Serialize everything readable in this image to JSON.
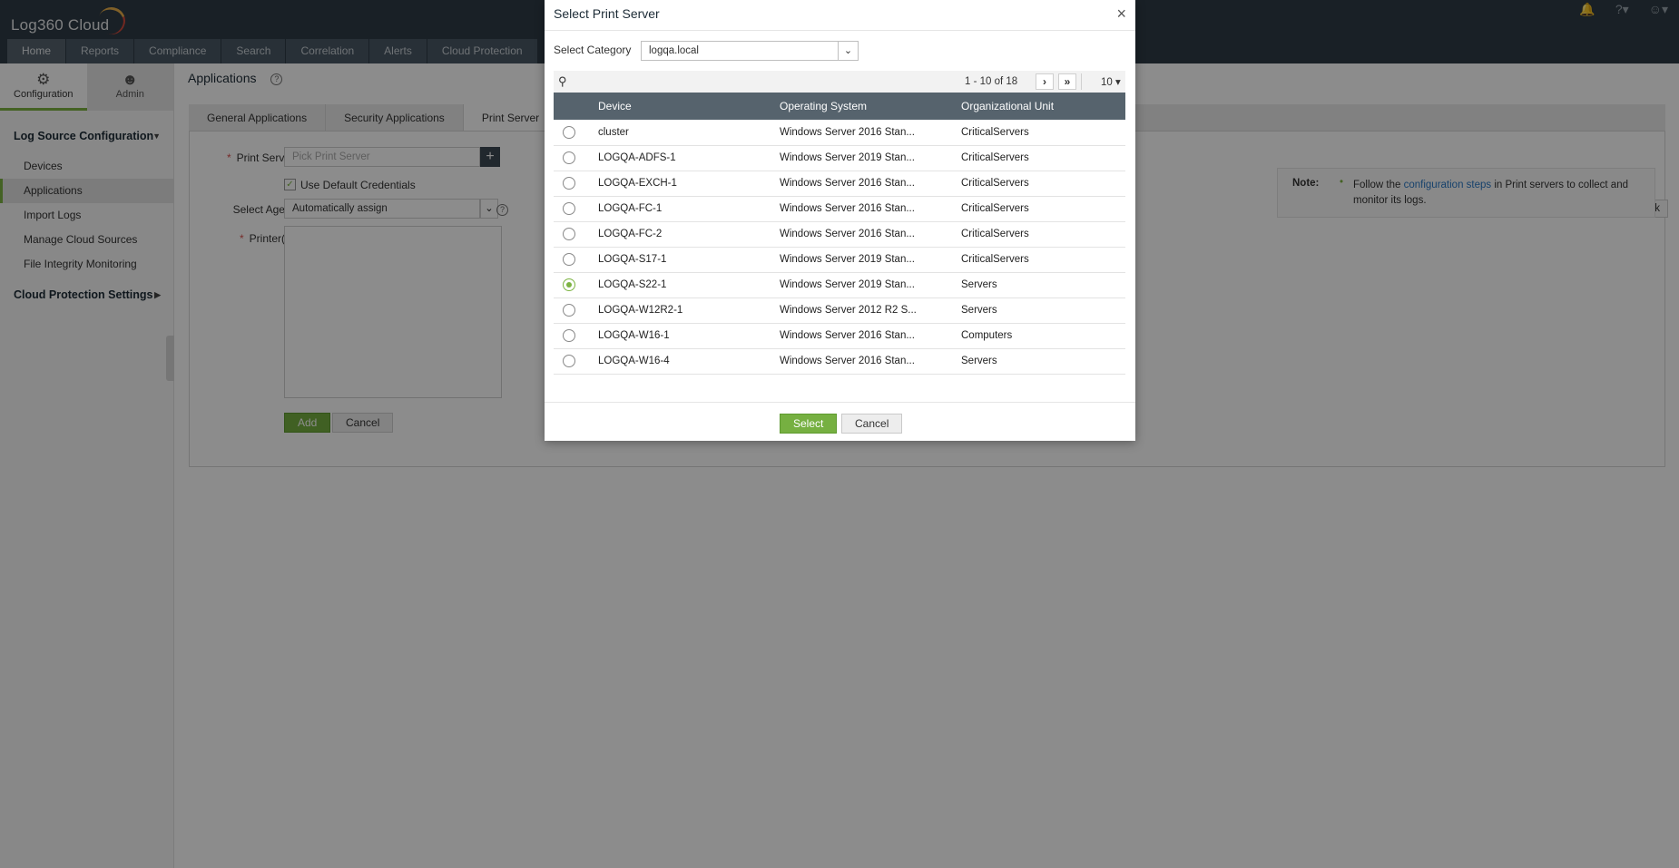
{
  "header": {
    "logo_text": "Log360 Cloud",
    "nav_tabs": [
      "Home",
      "Reports",
      "Compliance",
      "Search",
      "Correlation",
      "Alerts",
      "Cloud Protection"
    ],
    "icons": [
      "bell-icon",
      "help-icon",
      "user-icon"
    ]
  },
  "sidebar": {
    "tabs": [
      {
        "label": "Configuration",
        "icon": "gear-icon"
      },
      {
        "label": "Admin",
        "icon": "user-icon"
      }
    ],
    "section_log_source": "Log Source Configuration",
    "items": [
      "Devices",
      "Applications",
      "Import Logs",
      "Manage Cloud Sources",
      "File Integrity Monitoring"
    ],
    "section_cloud": "Cloud Protection Settings"
  },
  "main": {
    "page_title": "Applications",
    "app_tabs": [
      "General Applications",
      "Security Applications",
      "Print Server"
    ],
    "form": {
      "print_server_label": "Print Server",
      "print_server_placeholder": "Pick Print Server",
      "use_default_credentials": "Use Default Credentials",
      "select_agent_label": "Select Agent",
      "select_agent_value": "Automatically assign",
      "printers_label": "Printer(s)",
      "add_label": "Add",
      "cancel_label": "Cancel"
    },
    "back_label": "Back",
    "note": {
      "title": "Note:",
      "pre": "Follow the ",
      "link": "configuration steps",
      "post": " in Print servers to collect and monitor its logs."
    }
  },
  "modal": {
    "title": "Select Print Server",
    "close_label": "×",
    "category_label": "Select Category",
    "category_value": "logqa.local",
    "pager_text": "1 - 10 of 18",
    "per_page": "10",
    "columns": [
      "Device",
      "Operating System",
      "Organizational Unit"
    ],
    "rows": [
      {
        "device": "cluster",
        "os": "Windows Server 2016 Stan...",
        "ou": "CriticalServers",
        "selected": false
      },
      {
        "device": "LOGQA-ADFS-1",
        "os": "Windows Server 2019 Stan...",
        "ou": "CriticalServers",
        "selected": false
      },
      {
        "device": "LOGQA-EXCH-1",
        "os": "Windows Server 2016 Stan...",
        "ou": "CriticalServers",
        "selected": false
      },
      {
        "device": "LOGQA-FC-1",
        "os": "Windows Server 2016 Stan...",
        "ou": "CriticalServers",
        "selected": false
      },
      {
        "device": "LOGQA-FC-2",
        "os": "Windows Server 2016 Stan...",
        "ou": "CriticalServers",
        "selected": false
      },
      {
        "device": "LOGQA-S17-1",
        "os": "Windows Server 2019 Stan...",
        "ou": "CriticalServers",
        "selected": false
      },
      {
        "device": "LOGQA-S22-1",
        "os": "Windows Server 2019 Stan...",
        "ou": "Servers",
        "selected": true
      },
      {
        "device": "LOGQA-W12R2-1",
        "os": "Windows Server 2012 R2 S...",
        "ou": "Servers",
        "selected": false
      },
      {
        "device": "LOGQA-W16-1",
        "os": "Windows Server 2016 Stan...",
        "ou": "Computers",
        "selected": false
      },
      {
        "device": "LOGQA-W16-4",
        "os": "Windows Server 2016 Stan...",
        "ou": "Servers",
        "selected": false
      }
    ],
    "select_label": "Select",
    "cancel_label": "Cancel"
  },
  "colors": {
    "header_bg": "#2f3b45",
    "nav_tab_bg": "#4a5864",
    "grid_header_bg": "#56636d",
    "accent_green": "#76b041",
    "required_red": "#d9534f",
    "link_blue": "#2a78c5"
  }
}
